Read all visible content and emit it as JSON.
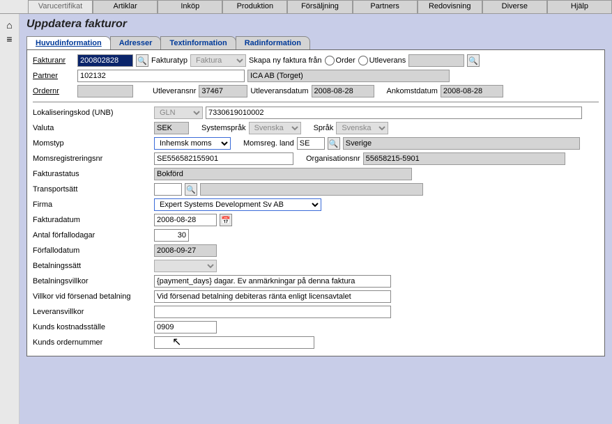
{
  "topTabs": [
    "Varucertifikat",
    "Artiklar",
    "Inköp",
    "Produktion",
    "Försäljning",
    "Partners",
    "Redovisning",
    "Diverse",
    "Hjälp"
  ],
  "pageTitle": "Uppdatera fakturor",
  "subTabs": [
    "Huvudinformation",
    "Adresser",
    "Textinformation",
    "Radinformation"
  ],
  "hdr": {
    "fakturanr_lbl": "Fakturanr",
    "fakturanr": "200802828",
    "fakturatyp_lbl": "Fakturatyp",
    "fakturatyp": "Faktura",
    "skapa_lbl": "Skapa ny faktura från",
    "order_lbl": "Order",
    "utlev_lbl": "Utleverans",
    "partner_lbl": "Partner",
    "partner_id": "102132",
    "partner_name": "ICA AB (Torget)",
    "ordernr_lbl": "Ordernr",
    "ordernr": "",
    "utleveransnr_lbl": "Utleveransnr",
    "utleveransnr": "37467",
    "utleveransdatum_lbl": "Utleveransdatum",
    "utleveransdatum": "2008-08-28",
    "ankomstdatum_lbl": "Ankomstdatum",
    "ankomstdatum": "2008-08-28"
  },
  "f": {
    "lokkod_lbl": "Lokaliseringskod (UNB)",
    "lokkod_sel": "GLN",
    "lokkod": "7330619010002",
    "valuta_lbl": "Valuta",
    "valuta": "SEK",
    "syssprak_lbl": "Systemspråk",
    "syssprak": "Svenska",
    "sprak_lbl": "Språk",
    "sprak": "Svenska",
    "momstyp_lbl": "Momstyp",
    "momstyp": "Inhemsk moms",
    "momsreg_land_lbl": "Momsreg. land",
    "momsreg_land": "SE",
    "momsreg_land_name": "Sverige",
    "momsregnr_lbl": "Momsregistreringsnr",
    "momsregnr": "SE556582155901",
    "orgnr_lbl": "Organisationsnr",
    "orgnr": "55658215-5901",
    "fakturastatus_lbl": "Fakturastatus",
    "fakturastatus": "Bokförd",
    "transportsatt_lbl": "Transportsätt",
    "transportsatt": "",
    "firma_lbl": "Firma",
    "firma": "Expert Systems Development Sv AB",
    "fakturadatum_lbl": "Fakturadatum",
    "fakturadatum": "2008-08-28",
    "antal_ff_lbl": "Antal förfallodagar",
    "antal_ff": "30",
    "forfallodatum_lbl": "Förfallodatum",
    "forfallodatum": "2008-09-27",
    "betalningssatt_lbl": "Betalningssätt",
    "betalningssatt": "",
    "betalningsvillkor_lbl": "Betalningsvillkor",
    "betalningsvillkor": "{payment_days} dagar. Ev anmärkningar på denna faktura",
    "villkor_forsenad_lbl": "Villkor vid försenad betalning",
    "villkor_forsenad": "Vid försenad betalning debiteras ränta enligt licensavtalet",
    "leveransvillkor_lbl": "Leveransvillkor",
    "leveransvillkor": "",
    "kunds_kost_lbl": "Kunds kostnadsställe",
    "kunds_kost": "0909",
    "kunds_ordernr_lbl": "Kunds ordernummer",
    "kunds_ordernr": ""
  }
}
